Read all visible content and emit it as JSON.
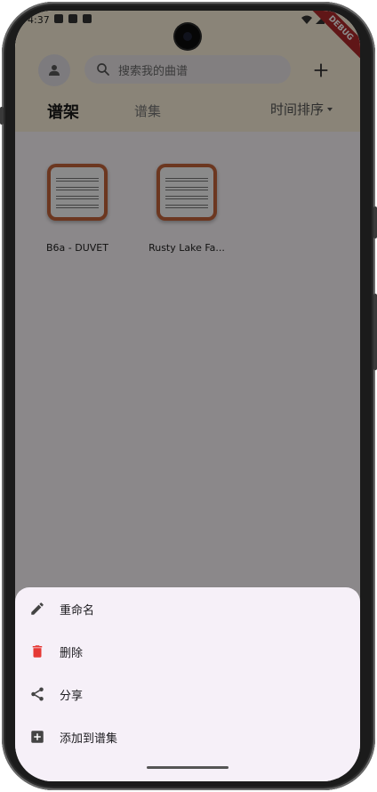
{
  "status_bar": {
    "time": "4:37"
  },
  "debug_banner": "DEBUG",
  "header": {
    "search_placeholder": "搜索我的曲谱",
    "tabs": [
      {
        "label": "谱架",
        "active": true
      },
      {
        "label": "谱集",
        "active": false
      }
    ],
    "sort_label": "时间排序"
  },
  "scores": [
    {
      "title": "B6a - DUVET"
    },
    {
      "title": "Rusty Lake Fa..."
    }
  ],
  "bottom_sheet": {
    "items": [
      {
        "label": "重命名",
        "icon": "pencil-icon"
      },
      {
        "label": "删除",
        "icon": "trash-icon",
        "color": "#e53935"
      },
      {
        "label": "分享",
        "icon": "share-icon"
      },
      {
        "label": "添加到谱集",
        "icon": "add-box-icon"
      }
    ]
  },
  "colors": {
    "header_bg": "#fbf1da",
    "thumb_border": "#c5653b",
    "delete_red": "#e53935",
    "sheet_bg": "#f6f0f8"
  }
}
